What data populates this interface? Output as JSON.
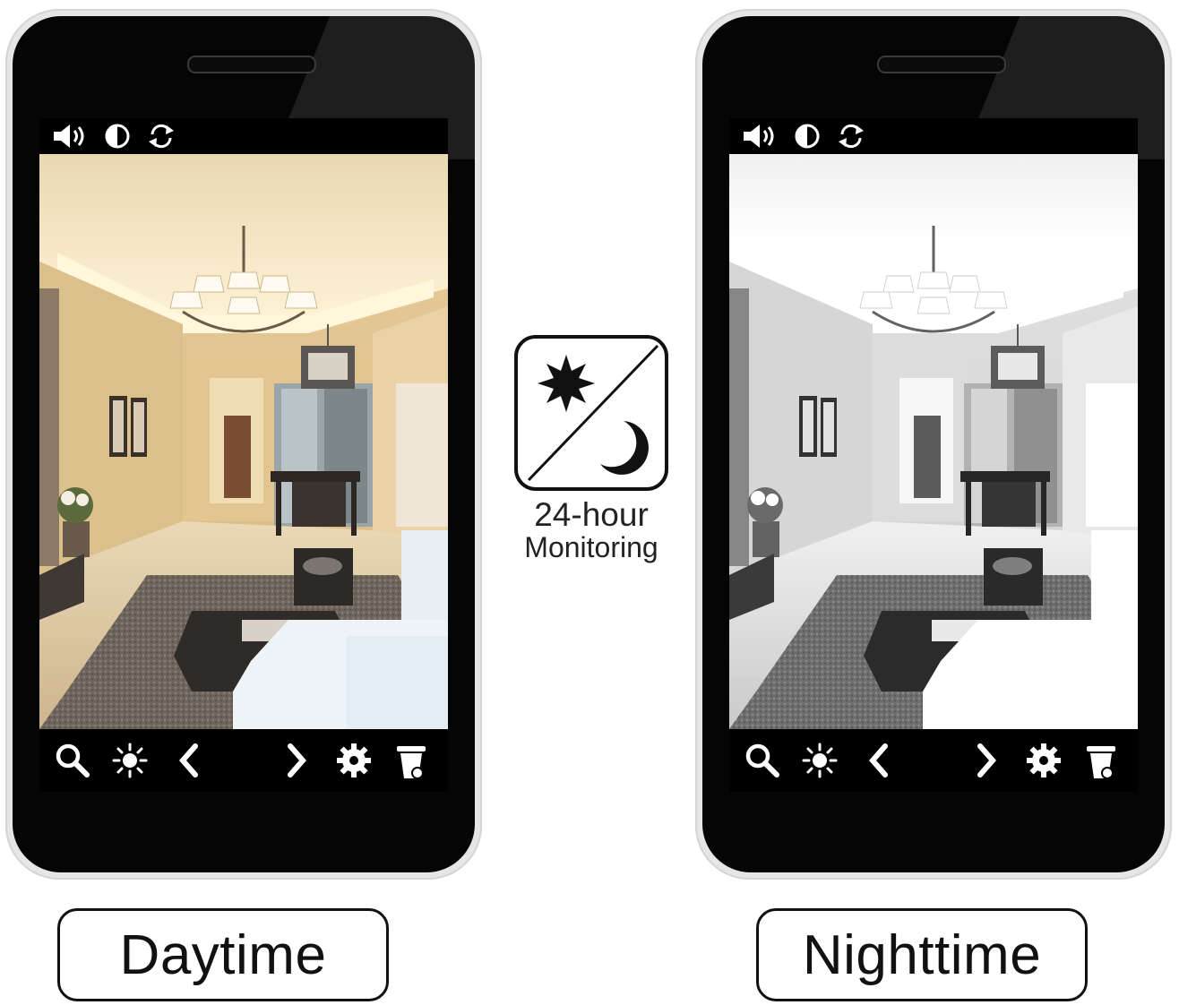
{
  "day_label": "Daytime",
  "night_label": "Nighttime",
  "center_badge": {
    "line1": "24-hour",
    "line2": "Monitoring",
    "icons": [
      "sun-icon",
      "moon-icon"
    ]
  },
  "phone_toolbar_top": [
    "speaker-icon",
    "contrast-icon",
    "refresh-icon"
  ],
  "phone_toolbar_bottom": [
    "search-icon",
    "brightness-icon",
    "chevron-left-icon",
    "chevron-right-icon",
    "gear-icon",
    "trash-icon"
  ]
}
